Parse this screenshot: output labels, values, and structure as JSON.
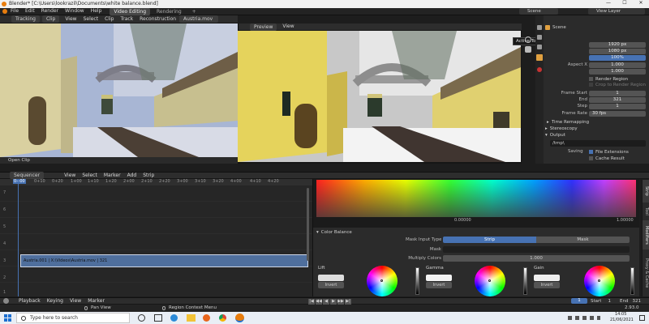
{
  "titlebar": {
    "title": "Blender* [C:\\Users\\lookrazil\\Documents\\white balance.blend]",
    "minimize": "—",
    "maximize": "☐",
    "close": "✕"
  },
  "topmenu": {
    "items": [
      "File",
      "Edit",
      "Render",
      "Window",
      "Help"
    ],
    "workspace_tabs": [
      "Video Editing",
      "Rendering"
    ],
    "add_tab": "+",
    "scene_label": "Scene",
    "view_layer_label": "View Layer"
  },
  "left_viewer": {
    "mode": "Tracking",
    "clip_type": "Clip",
    "menu": [
      "View",
      "Select",
      "Clip",
      "Track",
      "Reconstruction"
    ],
    "clip_name": "Austria.mov",
    "footer": "Open Clip"
  },
  "preview": {
    "mode": "Preview",
    "view": "View"
  },
  "tooltip": "Active Tool and Workspace settings",
  "properties": {
    "scene_name": "Scene",
    "resolution_x": "1920 px",
    "resolution_y": "1080 px",
    "resolution_pct": "100%",
    "aspect_x_label": "Aspect X",
    "aspect_x": "1.000",
    "aspect_y": "1.000",
    "render_region": "Render Region",
    "crop_region": "Crop to Render Region",
    "frame_start_label": "Frame Start",
    "frame_start": "1",
    "end_label": "End",
    "end": "321",
    "step_label": "Step",
    "step": "1",
    "frame_rate_label": "Frame Rate",
    "frame_rate": "30 fps",
    "time_remapping": "Time Remapping",
    "stereoscopy": "Stereoscopy",
    "output": "Output",
    "output_path": "/tmp\\",
    "saving_label": "Saving",
    "file_extensions": "File Extensions",
    "cache_result": "Cache Result"
  },
  "sequencer": {
    "editor": "Sequencer",
    "menu": [
      "View",
      "Select",
      "Marker",
      "Add",
      "Strip"
    ],
    "ruler": [
      "0+00",
      "0+10",
      "0+20",
      "1+00",
      "1+10",
      "1+20",
      "2+00",
      "2+10",
      "2+20",
      "3+00",
      "3+10",
      "3+20",
      "4+00",
      "4+10",
      "4+20"
    ],
    "channels": [
      "1",
      "2",
      "3",
      "4",
      "5",
      "6",
      "7"
    ],
    "strip_label": "Austria.001 | X:\\Videos\\Austria.mov | 321"
  },
  "scope": {
    "left_value": "0.00000",
    "right_value": "1.00000"
  },
  "color_balance": {
    "title": "Color Balance",
    "mask_input_label": "Mask Input Type",
    "mask_options": [
      "Strip",
      "Mask"
    ],
    "mask_label": "Mask",
    "multiply_label": "Multiply Colors",
    "multiply_value": "1.000",
    "lift_label": "Lift",
    "gamma_label": "Gamma",
    "gain_label": "Gain",
    "invert_label": "Invert"
  },
  "side_tabs": [
    "Strip",
    "Tool",
    "Modifiers",
    "Proxy & Cache"
  ],
  "playback": {
    "items": [
      "Playback",
      "Keying",
      "View",
      "Marker"
    ],
    "current_frame": "1",
    "start_label": "Start",
    "start": "1",
    "end_label": "End",
    "end": "321"
  },
  "statusbar": {
    "left": "Pan View",
    "middle": "Region Context Menu",
    "version": "2.93.0"
  },
  "taskbar": {
    "search_placeholder": "Type here to search",
    "time": "14:05",
    "date": "21/06/2021"
  }
}
